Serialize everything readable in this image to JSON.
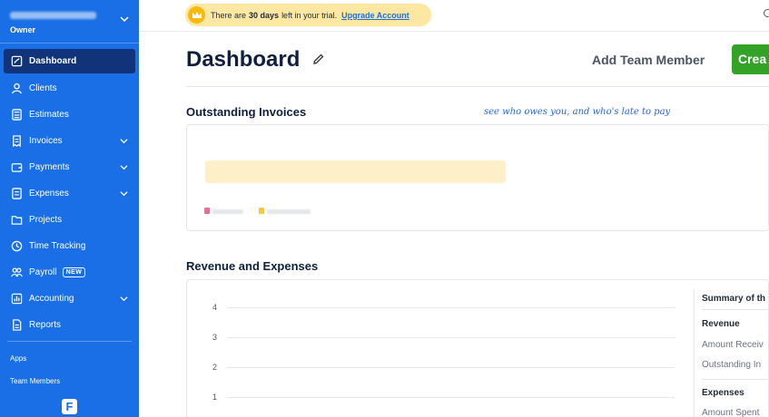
{
  "sidebar": {
    "business_role": "Owner",
    "items": [
      {
        "label": "Dashboard"
      },
      {
        "label": "Clients"
      },
      {
        "label": "Estimates"
      },
      {
        "label": "Invoices"
      },
      {
        "label": "Payments"
      },
      {
        "label": "Expenses"
      },
      {
        "label": "Projects"
      },
      {
        "label": "Time Tracking"
      },
      {
        "label": "Payroll",
        "badge": "NEW"
      },
      {
        "label": "Accounting"
      },
      {
        "label": "Reports"
      }
    ],
    "apps_label": "Apps",
    "team_members_label": "Team Members",
    "logo_letter": "F"
  },
  "trial_banner": {
    "prefix": "There are",
    "days": "30 days",
    "suffix": "left in your trial.",
    "upgrade_label": "Upgrade Account"
  },
  "header": {
    "title": "Dashboard",
    "add_team_member_label": "Add Team Member",
    "create_label": "Crea"
  },
  "outstanding_invoices": {
    "title": "Outstanding Invoices",
    "hint": "see who owes you, and who's late to pay"
  },
  "revenue_expenses": {
    "title": "Revenue and Expenses",
    "y_ticks": [
      "4",
      "3",
      "2",
      "1"
    ],
    "summary": {
      "title": "Summary of th",
      "revenue_label": "Revenue",
      "amount_received": "Amount Receiv",
      "outstanding": "Outstanding In",
      "expenses_label": "Expenses",
      "amount_spent": "Amount Spent"
    }
  },
  "colors": {
    "sidebar": "#1a6fe6",
    "sidebar_active": "#10337a",
    "create_button": "#32a327",
    "trial_banner": "#fde7a2"
  }
}
